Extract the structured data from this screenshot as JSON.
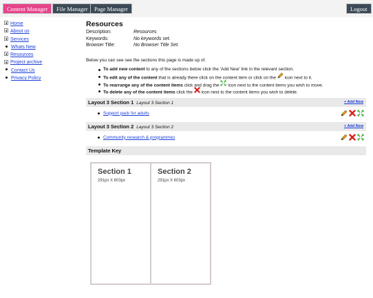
{
  "topbar": {
    "tabs": [
      {
        "label": "Content Manager",
        "active": true
      },
      {
        "label": "File Manager",
        "active": false
      },
      {
        "label": "Page Manager",
        "active": false
      }
    ],
    "logout_label": "Logout"
  },
  "sidebar": {
    "items": [
      {
        "label": "Home",
        "marker": "expand"
      },
      {
        "label": "About us",
        "marker": "expand"
      },
      {
        "label": "Services",
        "marker": "expand"
      },
      {
        "label": "Whats New",
        "marker": "bullet"
      },
      {
        "label": "Resources",
        "marker": "expand"
      },
      {
        "label": "Project archive",
        "marker": "expand"
      },
      {
        "label": "Contact Us",
        "marker": "bullet"
      },
      {
        "label": "Privacy Policy",
        "marker": "bullet"
      }
    ]
  },
  "page": {
    "title": "Resources",
    "meta": [
      {
        "label": "Description:",
        "value": "Resources"
      },
      {
        "label": "Keywords:",
        "value": "No keywords set."
      },
      {
        "label": "Browser Title:",
        "value": "No Browser Title Set."
      }
    ],
    "intro": "Below you can see see the sections this page is made up of.",
    "instructions": {
      "add": {
        "bold": "To add new content",
        "rest": " to any of the sections below click the 'Add New' link in the relevant section."
      },
      "edit": {
        "bold": "To edit any of the content",
        "rest": " that is already there click on the content item or click on the ",
        "rest2": " icon next to it."
      },
      "rearrange": {
        "bold": "To rearrange any of the content items",
        "rest": " click and drag the ",
        "rest2": " icon next to the content items you wish to move."
      },
      "delete": {
        "bold": "To delete any of the content items",
        "rest": " click the ",
        "rest2": " icon next to the content items you wish to delete."
      }
    }
  },
  "sections": [
    {
      "title": "Layout 3 Section 1",
      "subtitle": "Layout 3 Section 1",
      "add_new": "+ Add New",
      "item": "Support pack for adults"
    },
    {
      "title": "Layout 3 Section 2",
      "subtitle": "Layout 3 Section 2",
      "add_new": "+ Add New",
      "item": "Community research & programmes"
    }
  ],
  "template_key": {
    "heading": "Template Key",
    "columns": [
      {
        "title": "Section 1",
        "size": "291px X 603px"
      },
      {
        "title": "Section 2",
        "size": "291px X 603px"
      }
    ]
  },
  "colors": {
    "active_tab": "#e6448b",
    "inactive_tab": "#3c4a57",
    "link": "#1a3ed9",
    "bar_bg": "#e9e9e9",
    "edit_icon": "#e8a21a",
    "delete_icon": "#d42020",
    "move_icon": "#33aa33"
  },
  "icons": {
    "edit": "pencil-icon",
    "delete": "cross-icon",
    "move": "move-arrows-icon"
  }
}
